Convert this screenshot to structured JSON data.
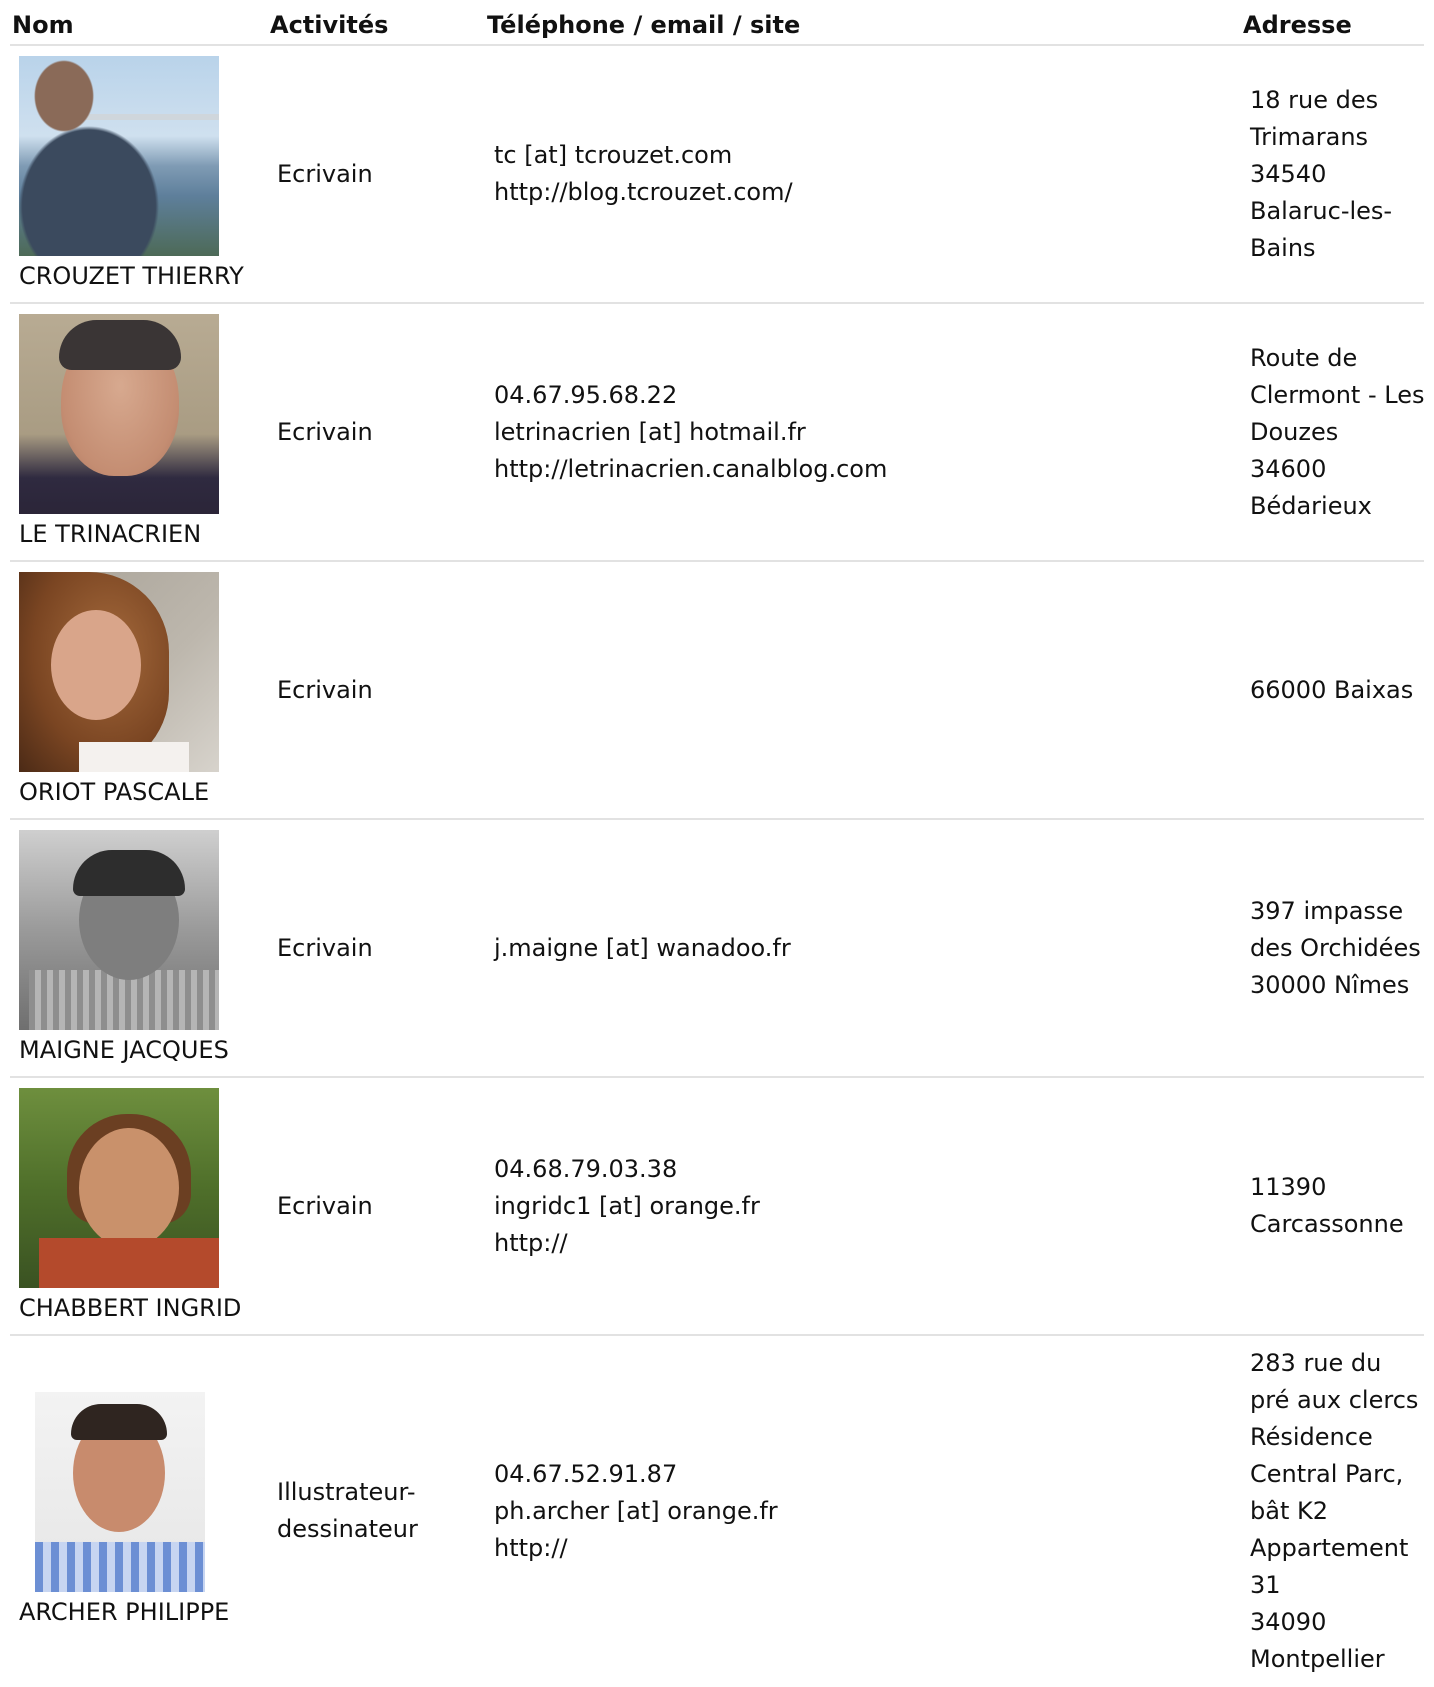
{
  "table": {
    "headers": {
      "nom": "Nom",
      "activites": "Activités",
      "contact": "Téléphone / email / site",
      "adresse": "Adresse"
    },
    "rows": [
      {
        "name": "CROUZET THIERRY",
        "activity": [
          "Ecrivain"
        ],
        "contact": [
          "tc [at] tcrouzet.com",
          "http://blog.tcrouzet.com/"
        ],
        "address": [
          "18 rue des",
          "Trimarans",
          "34540",
          "Balaruc-les-",
          "Bains"
        ]
      },
      {
        "name": "LE TRINACRIEN",
        "activity": [
          "Ecrivain"
        ],
        "contact": [
          "04.67.95.68.22",
          "letrinacrien [at] hotmail.fr",
          "http://letrinacrien.canalblog.com"
        ],
        "address": [
          "Route de",
          "Clermont - Les",
          "Douzes",
          "34600",
          "Bédarieux"
        ]
      },
      {
        "name": "ORIOT PASCALE",
        "activity": [
          "Ecrivain"
        ],
        "contact": [],
        "address": [
          "66000 Baixas"
        ]
      },
      {
        "name": "MAIGNE JACQUES",
        "activity": [
          "Ecrivain"
        ],
        "contact": [
          "j.maigne [at] wanadoo.fr"
        ],
        "address": [
          "397 impasse",
          "des Orchidées",
          "30000 Nîmes"
        ]
      },
      {
        "name": "CHABBERT INGRID",
        "activity": [
          "Ecrivain"
        ],
        "contact": [
          "04.68.79.03.38",
          "ingridc1 [at] orange.fr",
          "http://"
        ],
        "address": [
          "11390",
          "Carcassonne"
        ]
      },
      {
        "name": "ARCHER PHILIPPE",
        "activity": [
          "Illustrateur-",
          "dessinateur"
        ],
        "contact": [
          "04.67.52.91.87",
          "ph.archer [at] orange.fr",
          "http://"
        ],
        "address": [
          "283 rue du",
          "pré aux clercs",
          "Résidence",
          "Central Parc,",
          "bât K2",
          "Appartement",
          "31",
          "34090",
          "Montpellier"
        ]
      }
    ]
  }
}
